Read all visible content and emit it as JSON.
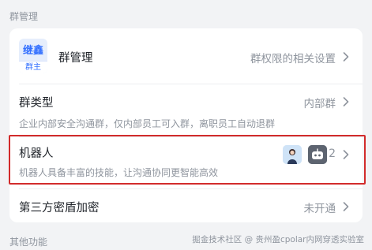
{
  "section_title": "群管理",
  "rows": {
    "group_admin": {
      "avatar_top": "继鑫",
      "avatar_badge": "群主",
      "title": "群管理",
      "right": "群权限的相关设置"
    },
    "group_type": {
      "title": "群类型",
      "right": "内部群",
      "desc": "企业内部安全沟通群，仅内部员工可入群，离职员工自动退群"
    },
    "bots": {
      "title": "机器人",
      "desc": "机器人具备丰富的技能，让沟通协同更智能高效",
      "count": "2"
    },
    "third_party_encryption": {
      "title": "第三方密盾加密",
      "right": "未开通"
    }
  },
  "footer_section_title": "其他功能",
  "watermark": "掘金技术社区 @ 贵州盈cpolar内网穿透实验室",
  "colors": {
    "accent": "#3370ff",
    "highlight": "#d22b2b",
    "muted": "#8f959e"
  }
}
